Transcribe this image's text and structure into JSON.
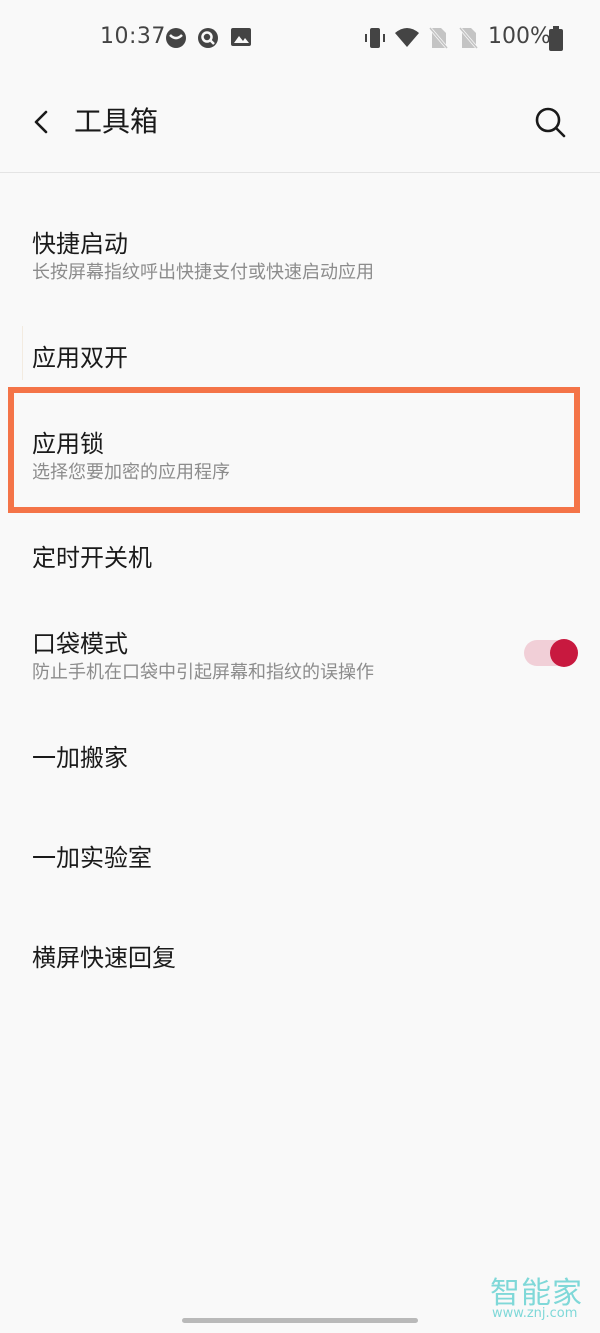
{
  "status_bar": {
    "time": "10:37",
    "battery": "100%",
    "left_icons": [
      "dot-icon",
      "chat-icon",
      "image-icon"
    ],
    "right_icons": [
      "vibrate-icon",
      "wifi-icon",
      "no-sim-icon",
      "no-sim-icon"
    ]
  },
  "header": {
    "title": "工具箱",
    "back_icon": "chevron-left-icon",
    "search_icon": "search-icon"
  },
  "items": [
    {
      "title": "快捷启动",
      "subtitle": "长按屏幕指纹呼出快捷支付或快速启动应用"
    },
    {
      "title": "应用双开"
    },
    {
      "title": "应用锁",
      "subtitle": "选择您要加密的应用程序",
      "highlighted": true
    },
    {
      "title": "定时开关机"
    },
    {
      "title": "口袋模式",
      "subtitle": "防止手机在口袋中引起屏幕和指纹的误操作",
      "toggle": true
    },
    {
      "title": "一加搬家"
    },
    {
      "title": "一加实验室"
    },
    {
      "title": "横屏快速回复"
    }
  ],
  "colors": {
    "highlight_border": "#f47448",
    "toggle_on": "#c8193f",
    "toggle_track": "#f1cfd7",
    "watermark": "#7fd8d8"
  },
  "watermark": {
    "logo": "智能家",
    "url": "www.znj.com"
  }
}
